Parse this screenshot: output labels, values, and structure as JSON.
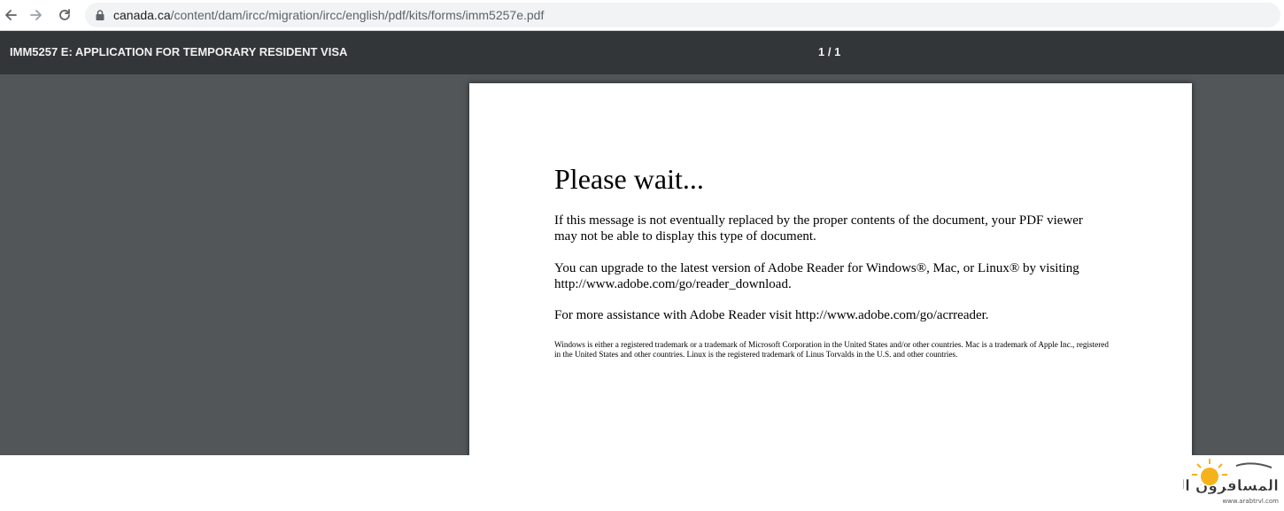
{
  "browser": {
    "url_domain": "canada.ca",
    "url_path": "/content/dam/ircc/migration/ircc/english/pdf/kits/forms/imm5257e.pdf",
    "icons": [
      "back-arrow-icon",
      "forward-arrow-icon",
      "reload-icon",
      "lock-icon"
    ]
  },
  "pdf_toolbar": {
    "title": "IMM5257 E: APPLICATION FOR TEMPORARY RESIDENT VISA",
    "page_indicator": "1 / 1"
  },
  "document": {
    "heading": "Please wait...",
    "paragraph_1": "If this message is not eventually replaced by the proper contents of the document, your PDF viewer may not be able to display this type of document.",
    "paragraph_2": "You can upgrade to the latest version of Adobe Reader for Windows®, Mac, or Linux® by visiting  http://www.adobe.com/go/reader_download.",
    "paragraph_3": "For more assistance with Adobe Reader visit  http://www.adobe.com/go/acrreader.",
    "fine_print": "Windows is either a registered trademark or a trademark of Microsoft Corporation in the United States and/or other countries. Mac is a trademark of Apple Inc., registered in the United States and other countries. Linux is the registered trademark of Linus Torvalds in the U.S. and other countries."
  },
  "watermark": {
    "text": "المسافرون العرب",
    "url": "www.arabtrvl.com"
  },
  "colors": {
    "toolbar_bg": "#323639",
    "viewer_bg": "#525659",
    "omnibox_bg": "#f1f3f4",
    "watermark_sun": "#f5b21b"
  }
}
